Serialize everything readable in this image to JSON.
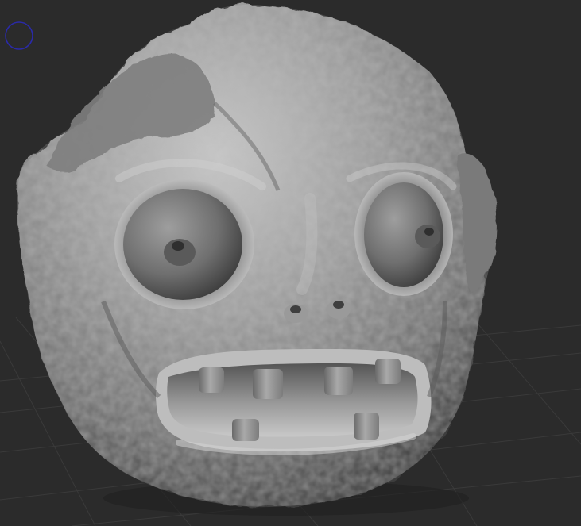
{
  "viewport": {
    "background_color": "#2b2b2b",
    "grid_color": "#3a3a3a",
    "model_color": "#8c8c8c",
    "model_highlight_color": "#c4c4c4",
    "model_shadow_color": "#3a3a3a",
    "cursor_ring_color": "#2a2aa8"
  }
}
